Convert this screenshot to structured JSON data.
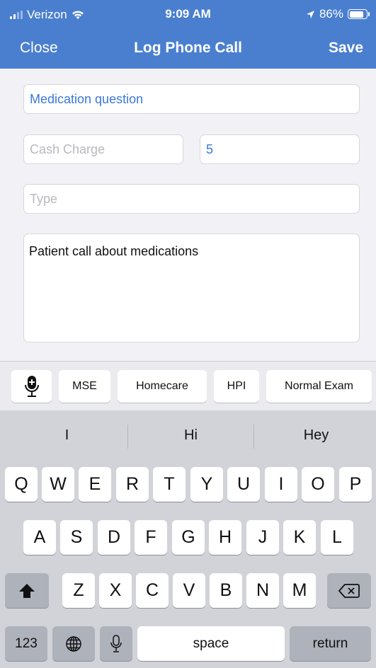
{
  "status_bar": {
    "carrier": "Verizon",
    "time": "9:09 AM",
    "battery": "86%",
    "battery_level": 0.86
  },
  "nav": {
    "close_label": "Close",
    "title": "Log Phone Call",
    "save_label": "Save"
  },
  "form": {
    "subject_value": "Medication question",
    "cash_charge_placeholder": "Cash Charge",
    "duration_value": "5",
    "type_placeholder": "Type",
    "notes_value": "Patient call about medications"
  },
  "accessory": {
    "buttons": [
      "MSE",
      "Homecare",
      "HPI",
      "Normal Exam"
    ]
  },
  "suggestions": [
    "I",
    "Hi",
    "Hey"
  ],
  "keyboard": {
    "row1": [
      "Q",
      "W",
      "E",
      "R",
      "T",
      "Y",
      "U",
      "I",
      "O",
      "P"
    ],
    "row2": [
      "A",
      "S",
      "D",
      "F",
      "G",
      "H",
      "J",
      "K",
      "L"
    ],
    "row3": [
      "Z",
      "X",
      "C",
      "V",
      "B",
      "N",
      "M"
    ],
    "numbers_label": "123",
    "space_label": "space",
    "return_label": "return"
  },
  "colors": {
    "nav_bar": "#4a7fcf",
    "accent": "#3b78d8"
  }
}
